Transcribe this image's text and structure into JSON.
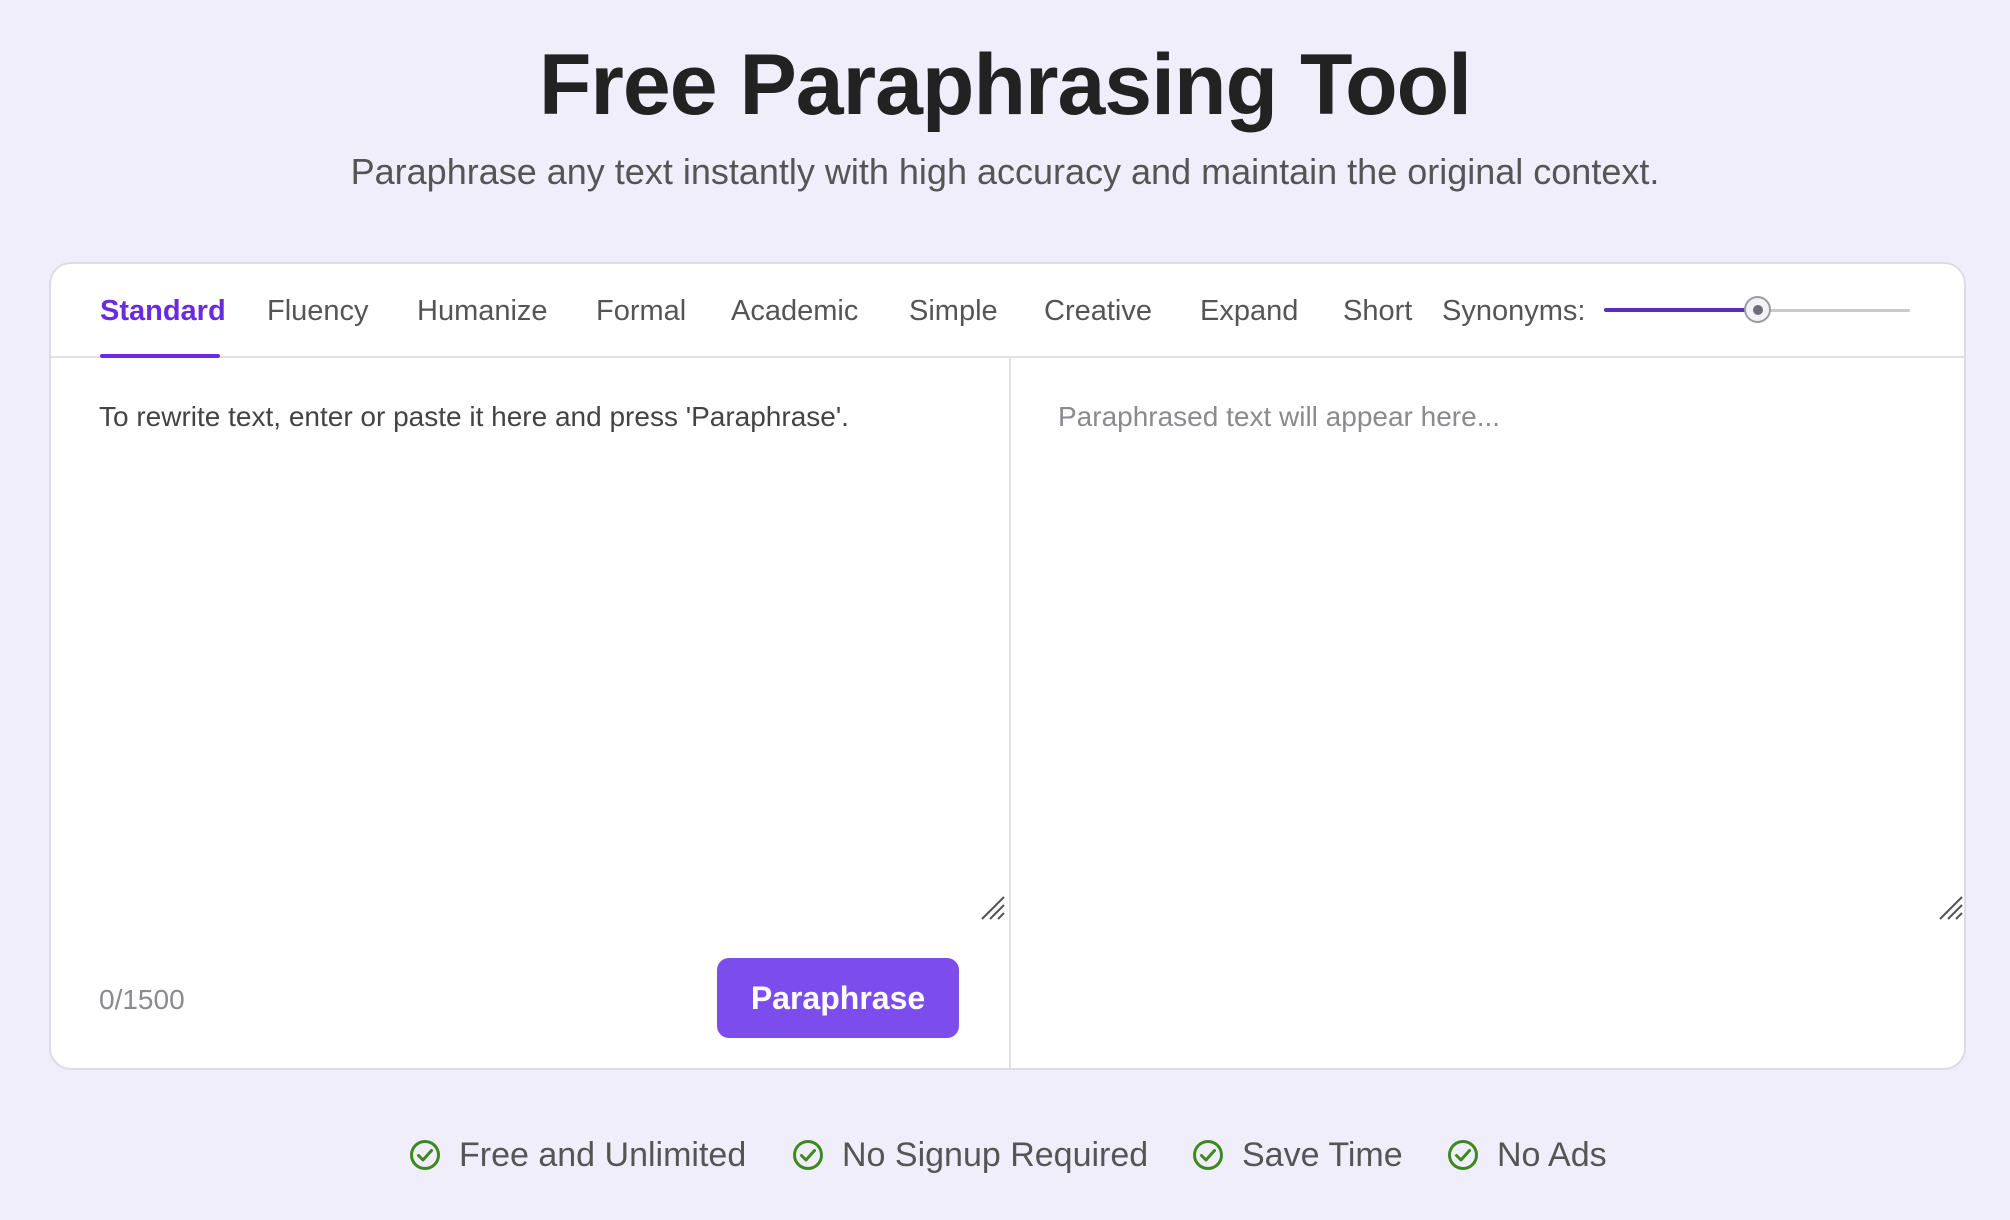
{
  "header": {
    "title": "Free Paraphrasing Tool",
    "subtitle": "Paraphrase any text instantly with high accuracy and maintain the original context."
  },
  "tabs": [
    {
      "label": "Standard",
      "active": true
    },
    {
      "label": "Fluency",
      "active": false
    },
    {
      "label": "Humanize",
      "active": false
    },
    {
      "label": "Formal",
      "active": false
    },
    {
      "label": "Academic",
      "active": false
    },
    {
      "label": "Simple",
      "active": false
    },
    {
      "label": "Creative",
      "active": false
    },
    {
      "label": "Expand",
      "active": false
    },
    {
      "label": "Short",
      "active": false
    }
  ],
  "synonyms": {
    "label": "Synonyms:",
    "level": 0.5
  },
  "input": {
    "placeholder": "To rewrite text, enter or paste it here and press 'Paraphrase'.",
    "char_count": "0/1500"
  },
  "output": {
    "placeholder": "Paraphrased text will appear here..."
  },
  "actions": {
    "paraphrase_label": "Paraphrase"
  },
  "features": [
    {
      "label": "Free and Unlimited",
      "icon": "check-circle-icon"
    },
    {
      "label": "No Signup Required",
      "icon": "check-circle-icon"
    },
    {
      "label": "Save Time",
      "icon": "check-circle-icon"
    },
    {
      "label": "No Ads",
      "icon": "check-circle-icon"
    }
  ],
  "colors": {
    "accent": "#6a2bde",
    "button": "#7c4dec",
    "background": "#f1eefc",
    "check": "#3c8a1e"
  }
}
